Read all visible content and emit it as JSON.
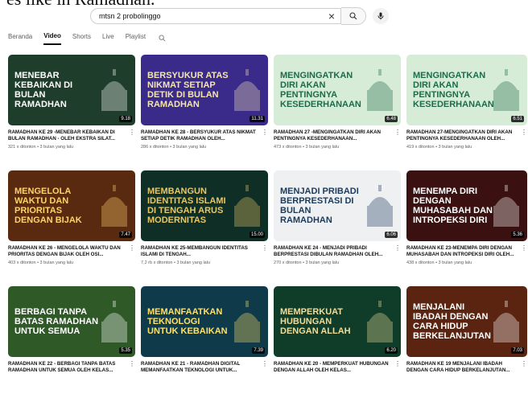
{
  "partial_top_text": "es like in Ramadhan.",
  "search": {
    "query": "mtsn 2 probolinggo"
  },
  "tabs": [
    {
      "label": "Beranda"
    },
    {
      "label": "Video"
    },
    {
      "label": "Shorts"
    },
    {
      "label": "Live"
    },
    {
      "label": "Playlist"
    }
  ],
  "videos": [
    {
      "title": "RAMADHAN KE 29 -MENEBAR KEBAIKAN DI BULAN RAMADHAN - OLEH EKSTRA SILAT...",
      "views": "321 x ditonton",
      "age": "3 bulan yang lalu",
      "duration": "9.18",
      "thumb_text": "MENEBAR KEBAIKAN DI BULAN RAMADHAN",
      "bg": "#1e3d2a",
      "fg": "#ffffff"
    },
    {
      "title": "RAMADHAN KE 28 - BERSYUKUR ATAS NIKMAT SETIAP DETIK RAMADHAN OLEH...",
      "views": "286 x ditonton",
      "age": "3 bulan yang lalu",
      "duration": "11.31",
      "thumb_text": "Bersyukur atas nikmat setiap detik di bulan Ramadhan",
      "bg": "#3a2a8a",
      "fg": "#f4e6b4"
    },
    {
      "title": "RAMADHAN 27 -MENGINGATKAN DIRI AKAN PENTINGNYA KESEDERHANAAN...",
      "views": "473 x ditonton",
      "age": "3 bulan yang lalu",
      "duration": "6.48",
      "thumb_text": "Mengingatkan diri akan pentingnya KESEDERHANAAN",
      "bg": "#d6ecd6",
      "fg": "#1d6b4a"
    },
    {
      "title": "RAMADHAN 27-MENGINGATKAN DIRI AKAN PENTINGNYA KESEDERHANAAN OLEH...",
      "views": "419 x ditonton",
      "age": "3 bulan yang lalu",
      "duration": "6.51",
      "thumb_text": "Mengingatkan diri akan pentingnya KESEDERHANAAN",
      "bg": "#d6ecd6",
      "fg": "#1d6b4a"
    },
    {
      "title": "RAMADHAN KE 26 - MENGELOLA WAKTU DAN PRIORITAS DENGAN BIJAK OLEH OSI...",
      "views": "403 x ditonton",
      "age": "3 bulan yang lalu",
      "duration": "7.47",
      "thumb_text": "MENGELOLA WAKTU DAN PRIORITAS DENGAN BIJAK",
      "bg": "#5a2a10",
      "fg": "#ffd26a"
    },
    {
      "title": "RAMADHAN KE 25-MEMBANGUN IDENTITAS ISLAMI DI TENGAH...",
      "views": "7,2 rb x ditonton",
      "age": "3 bulan yang lalu",
      "duration": "15.00",
      "thumb_text": "MEMBANGUN IDENTITAS ISLAMI DI TENGAH ARUS MODERNITAS",
      "bg": "#0f2f26",
      "fg": "#e8c766"
    },
    {
      "title": "RAMADHAN KE 24 - MENJADI PRIBADI BERPRESTASI DIBULAN RAMADHAN OLEH...",
      "views": "270 x ditonton",
      "age": "3 bulan yang lalu",
      "duration": "6.06",
      "thumb_text": "MENJADI PRIBADI BERPRESTASI DI BULAN RAMADHAN",
      "bg": "#eef0f2",
      "fg": "#1b3a5c"
    },
    {
      "title": "RAMADHAN KE 23-MENEMPA DIRI DENGAN MUHASABAH DAN INTROPEKSI DIRI OLEH...",
      "views": "438 x ditonton",
      "age": "3 bulan yang lalu",
      "duration": "5.36",
      "thumb_text": "MENEMPA DIRI DENGAN MUHASABAH DAN INTROPEKSI DIRI",
      "bg": "#3a1010",
      "fg": "#ffffff"
    },
    {
      "title": "RAMADHAN KE 22 - BERBAGI TANPA BATAS RAMADHAN UNTUK SEMUA OLEH KELAS...",
      "views": "",
      "age": "",
      "duration": "5.35",
      "thumb_text": "BERBAGI TANPA BATAS RAMADHAN UNTUK SEMUA",
      "bg": "#2f5a28",
      "fg": "#ffffff"
    },
    {
      "title": "RAMADHAN KE 21 - RAMADHAN DIGITAL MEMANFAATKAN TEKNOLOGI UNTUK...",
      "views": "",
      "age": "",
      "duration": "7.39",
      "thumb_text": "MEMANFAATKAN TEKNOLOGI UNTUK KEBAIKAN",
      "bg": "#0e3a4a",
      "fg": "#ffe066"
    },
    {
      "title": "RAMADHAN KE 20 - MEMPERKUAT HUBUNGAN DENGAN ALLAH OLEH KELAS...",
      "views": "",
      "age": "",
      "duration": "6.20",
      "thumb_text": "Memperkuat Hubungan dengan Allah",
      "bg": "#0f3d2a",
      "fg": "#f1dc9a"
    },
    {
      "title": "RAMADHAN KE 19 MENJALANI IBADAH DENGAN CARA HIDUP BERKELANJUTAN...",
      "views": "",
      "age": "",
      "duration": "7.03",
      "thumb_text": "MENJALANI IBADAH DENGAN CARA HIDUP BERKELANJUTAN",
      "bg": "#5a2410",
      "fg": "#ffffff"
    }
  ]
}
